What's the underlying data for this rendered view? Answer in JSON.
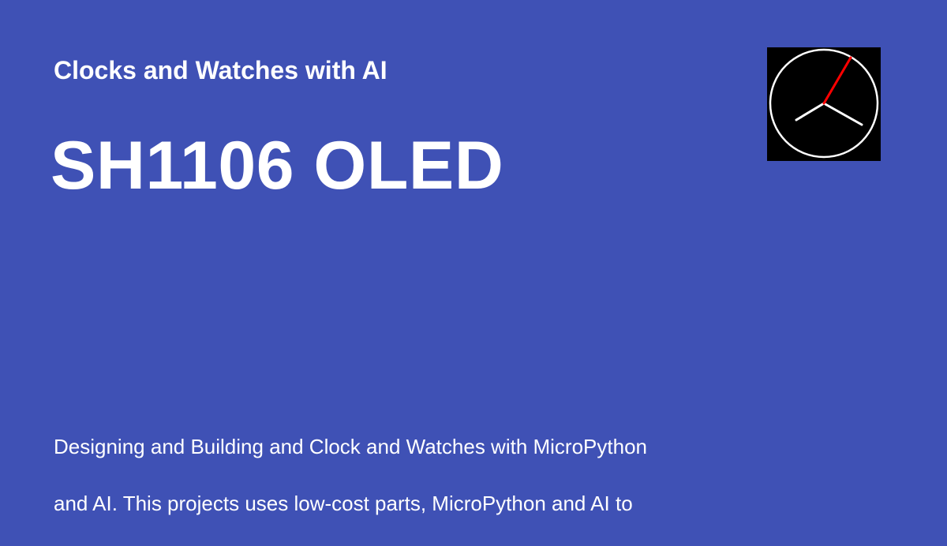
{
  "site": {
    "name": "Clocks and Watches with AI"
  },
  "page": {
    "title": "SH1106 OLED",
    "description_line1": "Designing and Building and Clock and Watches with MicroPython",
    "description_line2": "and AI.  This projects uses low-cost parts, MicroPython and AI to"
  },
  "logo": {
    "icon": "analog-clock-icon",
    "colors": {
      "face": "#000000",
      "outline": "#ffffff",
      "hands": "#ffffff",
      "second_hand": "#ff0000"
    }
  },
  "colors": {
    "background": "#3f51b5",
    "text": "#ffffff"
  }
}
